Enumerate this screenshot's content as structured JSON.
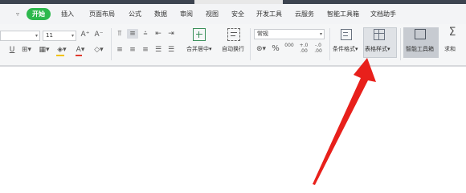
{
  "menu": {
    "dropdown_glyph": "▿",
    "start": "开始",
    "tabs": [
      "插入",
      "页面布局",
      "公式",
      "数据",
      "审阅",
      "视图",
      "安全",
      "开发工具",
      "云服务",
      "智能工具箱",
      "文档助手"
    ]
  },
  "font": {
    "size_value": "11",
    "grow_label": "A⁺",
    "shrink_label": "A⁻",
    "underline": "U",
    "font_color_letter": "A"
  },
  "alignment": {
    "merge_center": "合并居中",
    "wrap_text": "自动换行"
  },
  "number": {
    "format_value": "常规",
    "percent": "%",
    "thousands": "000",
    "increase_decimal": "+.0\n.00",
    "decrease_decimal": "-.0\n.00"
  },
  "styles": {
    "conditional_format": "条件格式",
    "table_style": "表格样式",
    "smart_toolbox": "智能工具箱",
    "sum": "求和"
  },
  "colors": {
    "accent_green": "#2db84d",
    "arrow_red": "#e8201b"
  }
}
